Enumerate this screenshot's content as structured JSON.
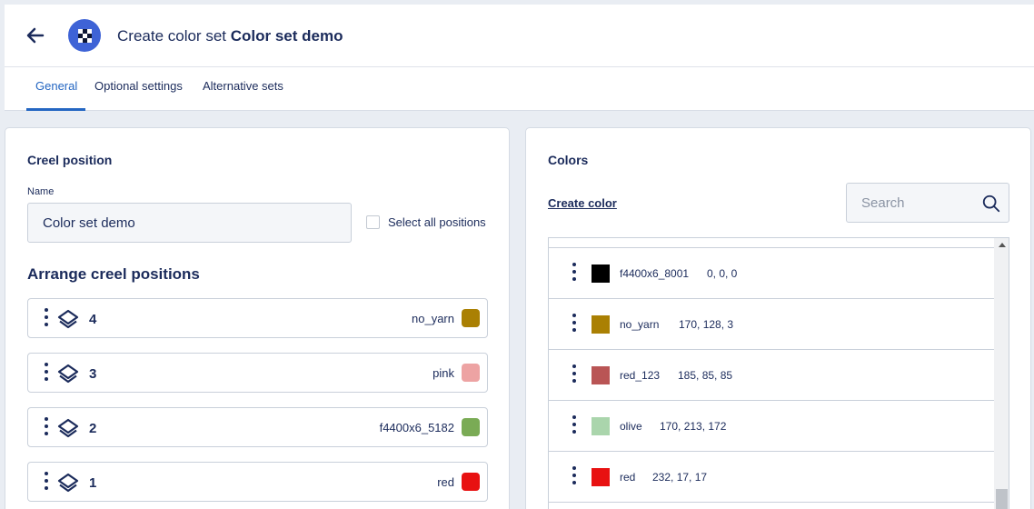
{
  "header": {
    "title_prefix": "Create color set ",
    "title_name": "Color set demo",
    "back_icon": "arrow-left-icon",
    "logo_icon": "checker-logo-icon"
  },
  "tabs": [
    {
      "label": "General",
      "active": true
    },
    {
      "label": "Optional settings",
      "active": false
    },
    {
      "label": "Alternative sets",
      "active": false
    }
  ],
  "creel_panel": {
    "title": "Creel position",
    "name_label": "Name",
    "name_value": "Color set demo",
    "select_all_label": "Select all positions",
    "select_all_checked": false,
    "arrange_title": "Arrange creel positions",
    "rows": [
      {
        "number": "4",
        "color_name": "no_yarn",
        "swatch": "#aa8003"
      },
      {
        "number": "3",
        "color_name": "pink",
        "swatch": "#eda3a3"
      },
      {
        "number": "2",
        "color_name": "f4400x6_5182",
        "swatch": "#7aab55"
      },
      {
        "number": "1",
        "color_name": "red",
        "swatch": "#e81111"
      }
    ]
  },
  "colors_panel": {
    "title": "Colors",
    "create_label": "Create color",
    "search_placeholder": "Search",
    "items": [
      {
        "name": "f4400x6_8001",
        "rgb": "0, 0, 0",
        "swatch": "#000000"
      },
      {
        "name": "no_yarn",
        "rgb": "170, 128, 3",
        "swatch": "#aa8003"
      },
      {
        "name": "red_123",
        "rgb": "185, 85, 85",
        "swatch": "#b95555"
      },
      {
        "name": "olive",
        "rgb": "170, 213, 172",
        "swatch": "#aad5ac"
      },
      {
        "name": "red",
        "rgb": "232, 17, 17",
        "swatch": "#e81111"
      }
    ]
  },
  "colors": {
    "accent": "#2466c2",
    "text": "#1b2b5b",
    "logo": "#3e63d6"
  }
}
